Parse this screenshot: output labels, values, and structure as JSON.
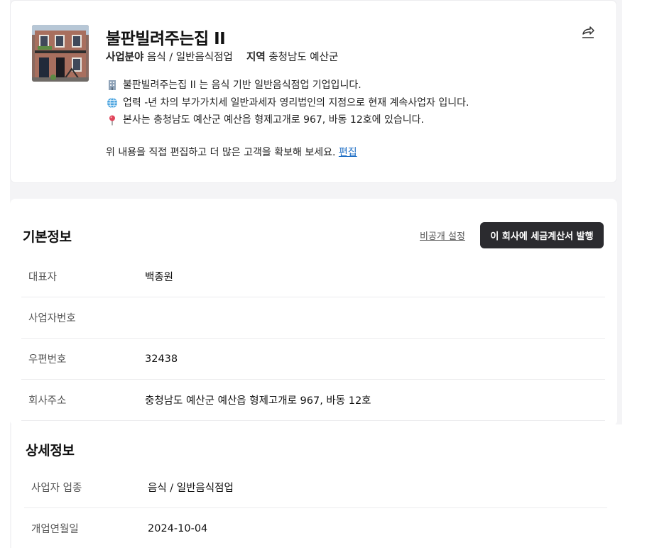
{
  "company": {
    "name": "불판빌려주는집 II",
    "industry_label": "사업분야",
    "industry_value": "음식 / 일반음식점업",
    "region_label": "지역",
    "region_value": "충청남도 예산군",
    "thumbnail_icon": "building-photo",
    "share_icon": "share-icon"
  },
  "description": [
    {
      "icon": "office-building-icon",
      "text": "불판빌려주는집 II 는 음식 기반 일반음식점업 기업입니다."
    },
    {
      "icon": "globe-icon",
      "text": "업력 -년 차의 부가가치세 일반과세자 영리법인의 지점으로 현재 계속사업자 입니다."
    },
    {
      "icon": "pin-icon",
      "text": "본사는 충청남도 예산군 예산읍 형제고개로 967, 바동 12호에 있습니다."
    }
  ],
  "edit_note": {
    "text": "위 내용을 직접 편집하고 더 많은 고객을 확보해 보세요.",
    "link": "편집"
  },
  "basic_info": {
    "title": "기본정보",
    "private_link": "비공개 설정",
    "tax_button": "이 회사에 세금계산서 발행",
    "rows": [
      {
        "label": "대표자",
        "value": "백종원"
      },
      {
        "label": "사업자번호",
        "value": ""
      },
      {
        "label": "우편번호",
        "value": "32438"
      },
      {
        "label": "회사주소",
        "value": "충청남도 예산군 예산읍 형제고개로 967, 바동 12호"
      }
    ]
  },
  "detail_info": {
    "title": "상세정보",
    "rows": [
      {
        "label": "사업자 업종",
        "value": "음식 / 일반음식점업"
      },
      {
        "label": "개업연월일",
        "value": "2024-10-04"
      }
    ]
  }
}
